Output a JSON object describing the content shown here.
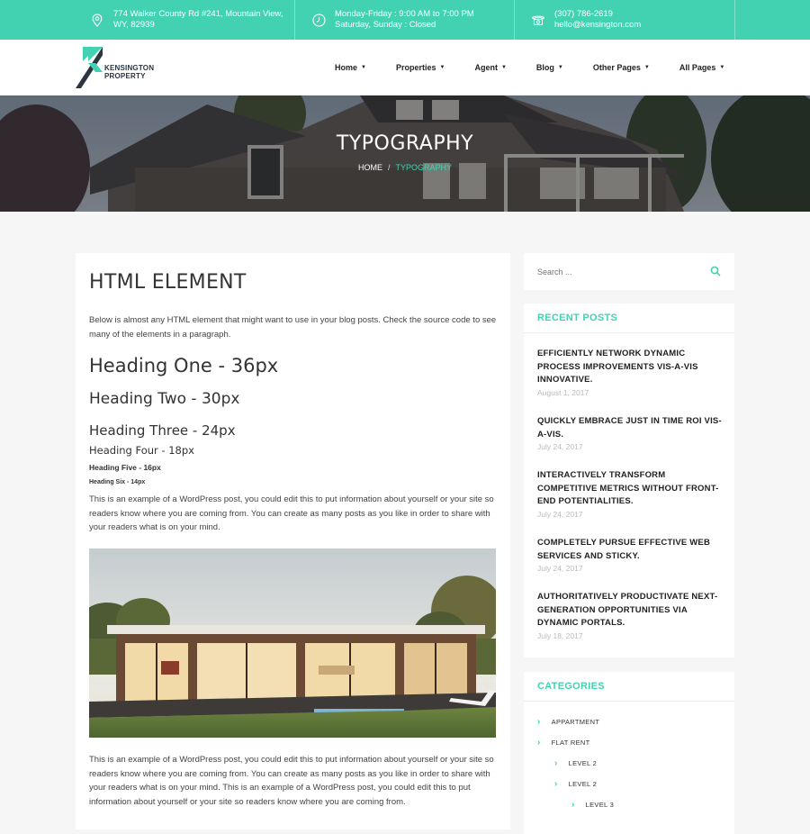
{
  "topbar": {
    "address_line1": "774 Walker County Rd #241, Mountain View,",
    "address_line2": "WY, 82939",
    "hours_line1": "Monday-Friday : 9:00 AM to 7:00 PM",
    "hours_line2": "Saturday, Sunday : Closed",
    "phone": "(307) 786-2619",
    "email": "hello@kensington.com"
  },
  "logo": {
    "line1": "KENSINGTON",
    "line2": "PROPERTY"
  },
  "nav": [
    {
      "label": "Home"
    },
    {
      "label": "Properties"
    },
    {
      "label": "Agent"
    },
    {
      "label": "Blog"
    },
    {
      "label": "Other Pages"
    },
    {
      "label": "All Pages"
    }
  ],
  "hero": {
    "title": "TYPOGRAPHY",
    "breadcrumb_home": "HOME",
    "breadcrumb_sep": "/",
    "breadcrumb_current": "TYPOGRAPHY"
  },
  "main": {
    "title": "HTML ELEMENT",
    "intro": "Below is almost any HTML element that might want to use in your blog posts. Check the source code to see many of the elements in a paragraph.",
    "h1": "Heading One - 36px",
    "h2": "Heading Two - 30px",
    "h3": "Heading Three - 24px",
    "h4": "Heading Four - 18px",
    "h5": "Heading Five - 16px",
    "h6": "Heading Six - 14px",
    "para1": "This is an example of a WordPress post, you could edit this to put information about yourself or your site so readers know where you are coming from. You can create as many posts as you like in order to share with your readers what is on your mind.",
    "para2": "This is an example of a WordPress post, you could edit this to put information about yourself or your site so readers know where you are coming from. You can create as many posts as you like in order to share with your readers what is on your mind. This is an example of a WordPress post, you could edit this to put information about yourself or your site so readers know where you are coming from."
  },
  "sidebar": {
    "search_placeholder": "Search ...",
    "recent_title": "RECENT POSTS",
    "posts": [
      {
        "title": "EFFICIENTLY NETWORK DYNAMIC PROCESS IMPROVEMENTS VIS-A-VIS INNOVATIVE.",
        "date": "August 1, 2017"
      },
      {
        "title": "QUICKLY EMBRACE JUST IN TIME ROI VIS-A-VIS.",
        "date": "July 24, 2017"
      },
      {
        "title": "INTERACTIVELY TRANSFORM COMPETITIVE METRICS WITHOUT FRONT-END POTENTIALITIES.",
        "date": "July 24, 2017"
      },
      {
        "title": "COMPLETELY PURSUE EFFECTIVE WEB SERVICES AND STICKY.",
        "date": "July 24, 2017"
      },
      {
        "title": "AUTHORITATIVELY PRODUCTIVATE NEXT-GENERATION OPPORTUNITIES VIA DYNAMIC PORTALS.",
        "date": "July 18, 2017"
      }
    ],
    "categories_title": "CATEGORIES",
    "categories": [
      {
        "label": "APPARTMENT"
      },
      {
        "label": "FLAT RENT"
      },
      {
        "label": "LEVEL 2"
      },
      {
        "label": "LEVEL 2"
      },
      {
        "label": "LEVEL 3"
      }
    ]
  },
  "colors": {
    "accent": "#43d2b1",
    "dark": "#2a3540"
  }
}
